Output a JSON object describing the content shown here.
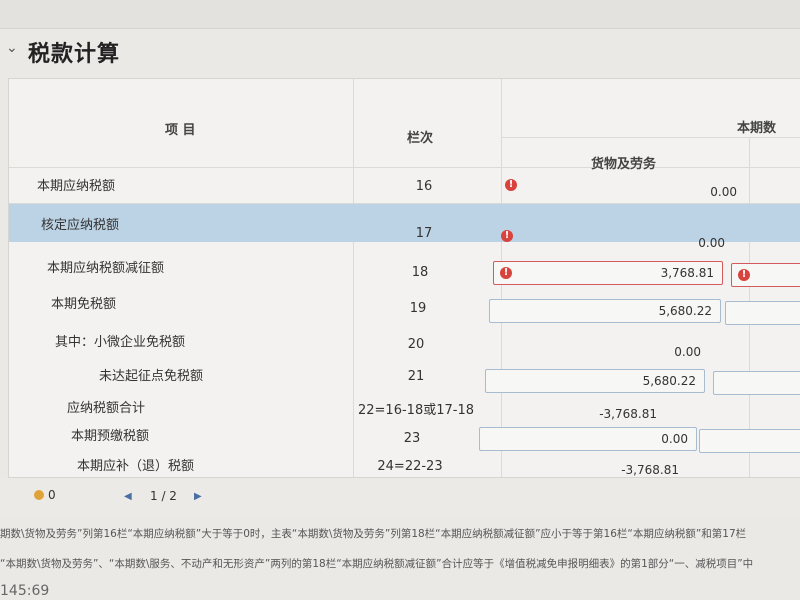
{
  "section": {
    "title": "税款计算"
  },
  "table": {
    "headers": {
      "item": "项 目",
      "column": "栏次",
      "current_period": "本期数",
      "goods_services": "货物及劳务"
    },
    "rows": [
      {
        "label": "本期应纳税额",
        "col": "16",
        "value": "0.00",
        "warn": true,
        "editable": false
      },
      {
        "label": "核定应纳税额",
        "col": "17",
        "value": "0.00",
        "warn": true,
        "editable": false
      },
      {
        "label": "本期应纳税额减征额",
        "col": "18",
        "value": "3,768.81",
        "warn": true,
        "editable": true
      },
      {
        "label": "本期免税额",
        "col": "19",
        "value": "5,680.22",
        "warn": false,
        "editable": true
      },
      {
        "label": "其中：小微企业免税额",
        "col": "20",
        "value": "0.00",
        "warn": false,
        "editable": false
      },
      {
        "label": "未达起征点免税额",
        "col": "21",
        "value": "5,680.22",
        "warn": false,
        "editable": true
      },
      {
        "label": "应纳税额合计",
        "col": "22=16-18或17-18",
        "value": "-3,768.81",
        "warn": false,
        "editable": false
      },
      {
        "label": "本期预缴税额",
        "col": "23",
        "value": "0.00",
        "warn": false,
        "editable": true
      },
      {
        "label": "本期应补（退）税额",
        "col": "24=22-23",
        "value": "-3,768.81",
        "warn": false,
        "editable": false
      }
    ]
  },
  "footer": {
    "count": "0",
    "page": "1 / 2",
    "prev_icon": "chevron-left-icon",
    "next_icon": "chevron-right-icon"
  },
  "notes": {
    "line1": "期数\\货物及劳务”列第16栏“本期应纳税额”大于等于0时，主表“本期数\\货物及劳务”列第18栏“本期应纳税额减征额”应小于等于第16栏“本期应纳税额”和第17栏",
    "line2": "“本期数\\货物及劳务”、“本期数\\服务、不动产和无形资产”两列的第18栏“本期应纳税额减征额”合计应等于《增值税减免申报明细表》的第1部分“一、减税项目”中",
    "time": "145:69"
  },
  "colors": {
    "error": "#d9433d",
    "selected_row": "#bcd3e5",
    "input_border": "#a7bcd1"
  }
}
